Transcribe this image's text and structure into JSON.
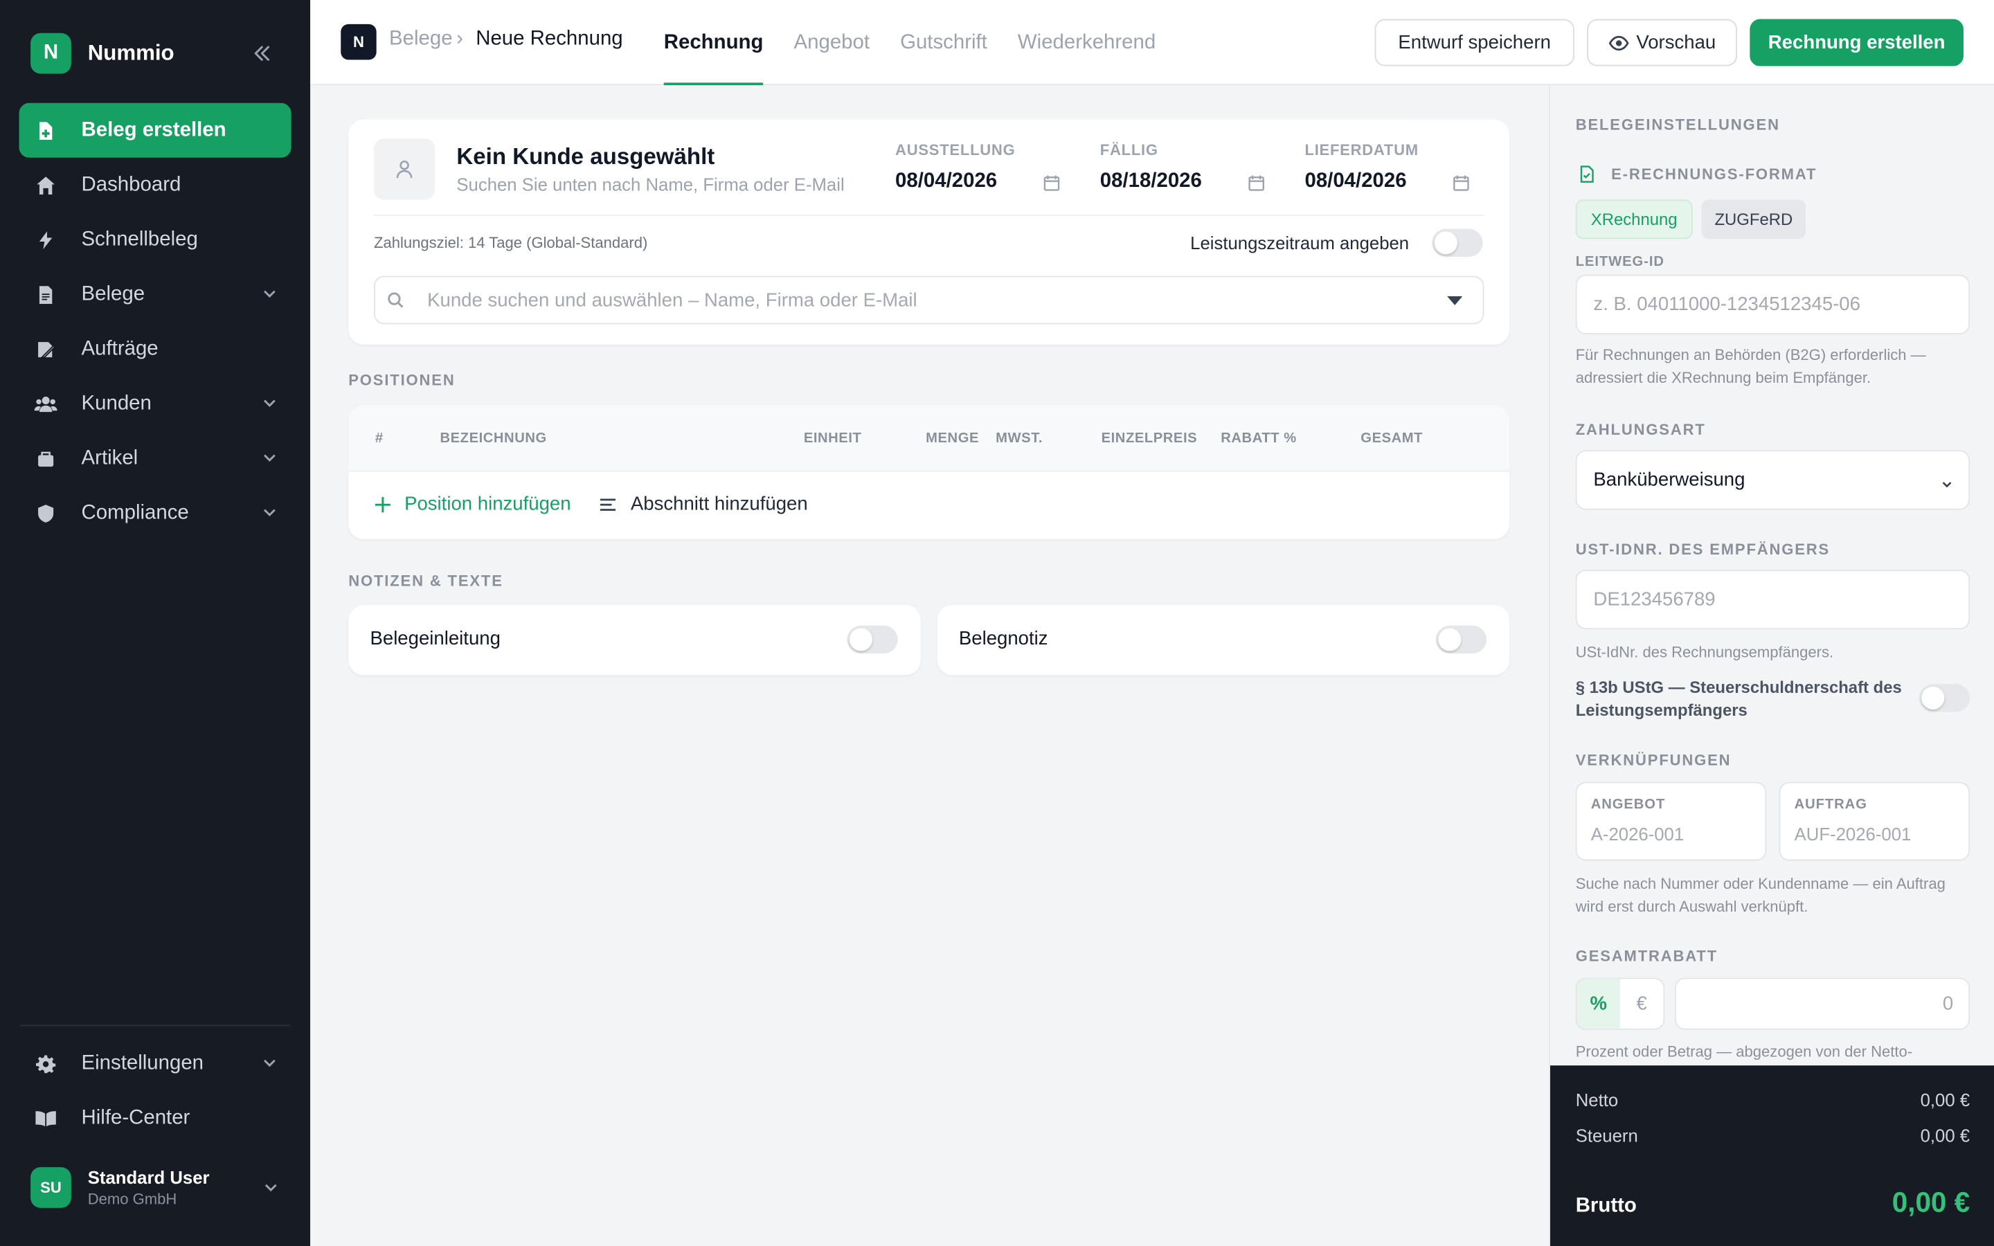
{
  "app": {
    "name": "Nummio",
    "logo_letter": "N"
  },
  "colors": {
    "accent": "#16a064",
    "sidebar_bg": "#171c24",
    "total_green": "#34c27a"
  },
  "sidebar": {
    "items": [
      {
        "label": "Beleg erstellen",
        "icon": "file-plus-icon",
        "active": true
      },
      {
        "label": "Dashboard",
        "icon": "home-icon"
      },
      {
        "label": "Schnellbeleg",
        "icon": "bolt-icon"
      },
      {
        "label": "Belege",
        "icon": "document-icon",
        "expandable": true
      },
      {
        "label": "Aufträge",
        "icon": "clipboard-icon"
      },
      {
        "label": "Kunden",
        "icon": "users-icon",
        "expandable": true
      },
      {
        "label": "Artikel",
        "icon": "box-icon",
        "expandable": true
      },
      {
        "label": "Compliance",
        "icon": "shield-icon",
        "expandable": true
      }
    ],
    "bottom": [
      {
        "label": "Einstellungen",
        "icon": "gear-icon",
        "expandable": true
      },
      {
        "label": "Hilfe-Center",
        "icon": "book-icon"
      }
    ],
    "user": {
      "initials": "SU",
      "name": "Standard User",
      "org": "Demo GmbH"
    }
  },
  "topbar": {
    "crumb_logo": "N",
    "breadcrumb_parent": "Belege",
    "breadcrumb_sep": "›",
    "breadcrumb_current": "Neue Rechnung",
    "tabs": [
      "Rechnung",
      "Angebot",
      "Gutschrift",
      "Wiederkehrend"
    ],
    "active_tab": "Rechnung",
    "draft_label": "Entwurf speichern",
    "preview_label": "Vorschau",
    "create_label": "Rechnung erstellen"
  },
  "customer": {
    "title": "Kein Kunde ausgewählt",
    "subtitle": "Suchen Sie unten nach Name, Firma oder E-Mail",
    "dates": [
      {
        "label": "AUSSTELLUNG",
        "value": "08/04/2026"
      },
      {
        "label": "FÄLLIG",
        "value": "08/18/2026"
      },
      {
        "label": "LIEFERDATUM",
        "value": "08/04/2026"
      }
    ],
    "payment_term": "Zahlungsziel: 14 Tage (Global-Standard)",
    "period_label": "Leistungszeitraum angeben",
    "period_enabled": false,
    "search_placeholder": "Kunde suchen und auswählen – Name, Firma oder E-Mail"
  },
  "positions": {
    "section_title": "POSITIONEN",
    "columns": [
      "#",
      "BEZEICHNUNG",
      "EINHEIT",
      "MENGE",
      "MWST.",
      "EINZELPREIS",
      "RABATT %",
      "GESAMT"
    ],
    "add_position": "Position hinzufügen",
    "add_section": "Abschnitt hinzufügen"
  },
  "notes": {
    "section_title": "NOTIZEN & TEXTE",
    "items": [
      {
        "label": "Belegeinleitung",
        "enabled": false
      },
      {
        "label": "Belegnotiz",
        "enabled": false
      }
    ]
  },
  "settings": {
    "title": "BELEGEINSTELLUNGEN",
    "erechnung_label": "E-RECHNUNGS-FORMAT",
    "formats": [
      "XRechnung",
      "ZUGFeRD"
    ],
    "selected_format": "XRechnung",
    "leitweg_label": "LEITWEG-ID",
    "leitweg_placeholder": "z. B. 04011000-1234512345-06",
    "leitweg_help": "Für Rechnungen an Behörden (B2G) erforderlich — adressiert die XRechnung beim Empfänger.",
    "payment_label": "ZAHLUNGSART",
    "payment_value": "Banküberweisung",
    "vat_label": "UST-IDNR. DES EMPFÄNGERS",
    "vat_placeholder": "DE123456789",
    "vat_help": "USt-IdNr. des Rechnungsempfängers.",
    "reverse_charge_label": "§ 13b UStG — Steuerschuldnerschaft des Leistungsempfängers",
    "reverse_charge_enabled": false,
    "links_label": "VERKNÜPFUNGEN",
    "offer_label": "ANGEBOT",
    "offer_placeholder": "A-2026-001",
    "order_label": "AUFTRAG",
    "order_placeholder": "AUF-2026-001",
    "links_help": "Suche nach Nummer oder Kundenname — ein Auftrag wird erst durch Auswahl verknüpft.",
    "discount_label": "GESAMTRABATT",
    "discount_modes": [
      "%",
      "€"
    ],
    "discount_mode": "%",
    "discount_placeholder": "0",
    "discount_help": "Prozent oder Betrag — abgezogen von der Netto-"
  },
  "totals": {
    "netto_label": "Netto",
    "netto_value": "0,00 €",
    "tax_label": "Steuern",
    "tax_value": "0,00 €",
    "brutto_label": "Brutto",
    "brutto_value": "0,00 €"
  }
}
